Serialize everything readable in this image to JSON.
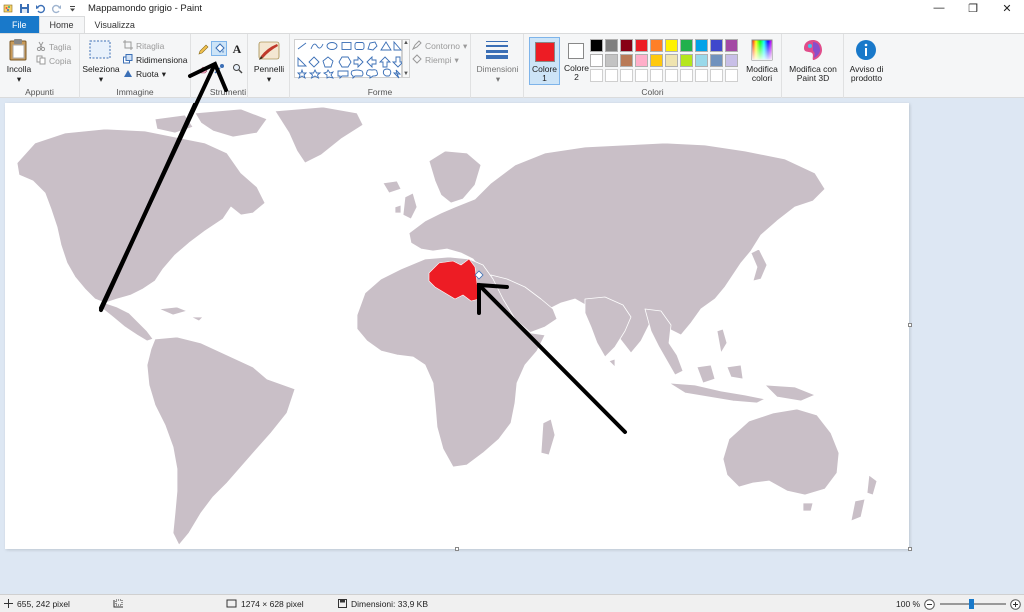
{
  "window": {
    "title": "Mappamondo grigio - Paint"
  },
  "tabs": {
    "file": "File",
    "home": "Home",
    "view": "Visualizza"
  },
  "ribbon": {
    "clipboard": {
      "paste": "Incolla",
      "cut": "Taglia",
      "copy": "Copia",
      "group": "Appunti"
    },
    "image": {
      "select": "Seleziona",
      "crop": "Ritaglia",
      "resize": "Ridimensiona",
      "rotate": "Ruota",
      "group": "Immagine"
    },
    "tools": {
      "group": "Strumenti"
    },
    "brushes": {
      "label": "Pennelli"
    },
    "shapes": {
      "outline": "Contorno",
      "fill": "Riempi",
      "group": "Forme"
    },
    "size": {
      "label": "Dimensioni"
    },
    "colors": {
      "color1": "Colore 1",
      "color2": "Colore 2",
      "edit": "Modifica colori",
      "group": "Colori",
      "color1_value": "#ed1c24",
      "color2_value": "#ffffff",
      "palette_row1": [
        "#000000",
        "#7f7f7f",
        "#880015",
        "#ed1c24",
        "#ff7f27",
        "#fff200",
        "#22b14c",
        "#00a2e8",
        "#3f48cc",
        "#a349a4"
      ],
      "palette_row2": [
        "#ffffff",
        "#c3c3c3",
        "#b97a57",
        "#ffaec9",
        "#ffc90e",
        "#efe4b0",
        "#b5e61d",
        "#99d9ea",
        "#7092be",
        "#c8bfe7"
      ]
    },
    "paint3d": {
      "label": "Modifica con Paint 3D"
    },
    "notice": {
      "label": "Avviso di prodotto"
    }
  },
  "status": {
    "cursor": "655, 242 pixel",
    "image_size": "1274 × 628 pixel",
    "file_size": "Dimensioni: 33,9 KB",
    "zoom": "100 %"
  },
  "map": {
    "land_color": "#c9bfc7",
    "highlight_color": "#ed1c24"
  }
}
